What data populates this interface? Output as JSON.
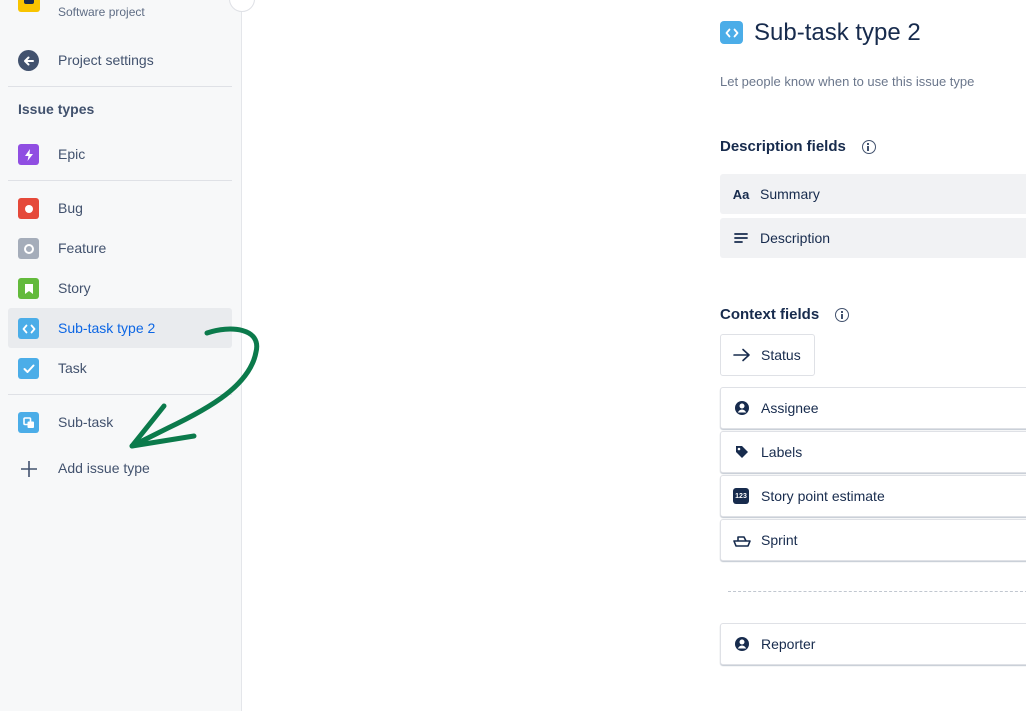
{
  "sidebar": {
    "project_subtitle": "Software project",
    "project_settings": "Project settings",
    "issue_types_heading": "Issue types",
    "items": [
      {
        "label": "Epic",
        "color": "#904ee2"
      },
      {
        "label": "Bug",
        "color": "#e5493a"
      },
      {
        "label": "Feature",
        "color": "#a5adba"
      },
      {
        "label": "Story",
        "color": "#63ba3c"
      },
      {
        "label": "Sub-task type 2",
        "color": "#4bade8"
      },
      {
        "label": "Task",
        "color": "#4bade8"
      },
      {
        "label": "Sub-task",
        "color": "#4bade8"
      }
    ],
    "add_issue_type": "Add issue type"
  },
  "main": {
    "title": "Sub-task type 2",
    "subtitle": "Let people know when to use this issue type",
    "description_heading": "Description fields",
    "description_fields": [
      {
        "icon": "Aa",
        "label": "Summary"
      },
      {
        "icon": "description-icon",
        "label": "Description"
      }
    ],
    "context_heading": "Context fields",
    "context_fields": [
      {
        "icon": "arrow-right-icon",
        "label": "Status"
      },
      {
        "icon": "person-icon",
        "label": "Assignee"
      },
      {
        "icon": "tag-icon",
        "label": "Labels"
      },
      {
        "icon": "123",
        "label": "Story point estimate"
      },
      {
        "icon": "boat-icon",
        "label": "Sprint"
      },
      {
        "icon": "person-icon",
        "label": "Reporter"
      }
    ]
  },
  "annotation_color": "#0b7a4b"
}
